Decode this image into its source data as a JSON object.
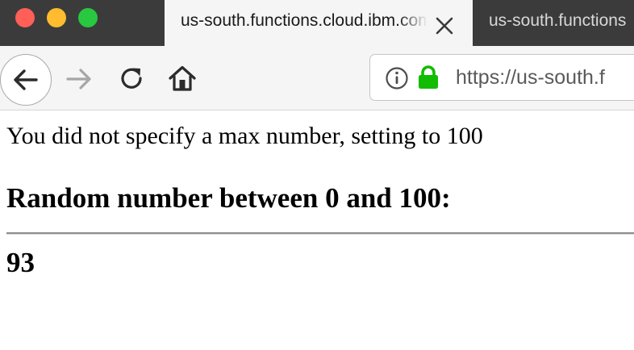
{
  "browser": {
    "tabs": [
      {
        "title": "us-south.functions.cloud.ibm.com",
        "active": true
      },
      {
        "title": "us-south.functions",
        "active": false
      }
    ],
    "address_bar": {
      "url": "https://us-south.f"
    }
  },
  "page": {
    "message": "You did not specify a max number, setting to 100",
    "heading": "Random number between 0 and 100:",
    "result": "93"
  },
  "colors": {
    "tabstrip_bg": "#3b3b3b",
    "toolbar_bg": "#f5f5f5",
    "lock_green": "#12bc00",
    "close_button": "#fe5f57",
    "minimize_button": "#febc2e",
    "zoom_button": "#28c840"
  },
  "icons": [
    "close-window-icon",
    "minimize-window-icon",
    "zoom-window-icon",
    "tab-close-icon",
    "back-arrow-icon",
    "forward-arrow-icon",
    "reload-icon",
    "home-icon",
    "info-icon",
    "lock-icon"
  ]
}
